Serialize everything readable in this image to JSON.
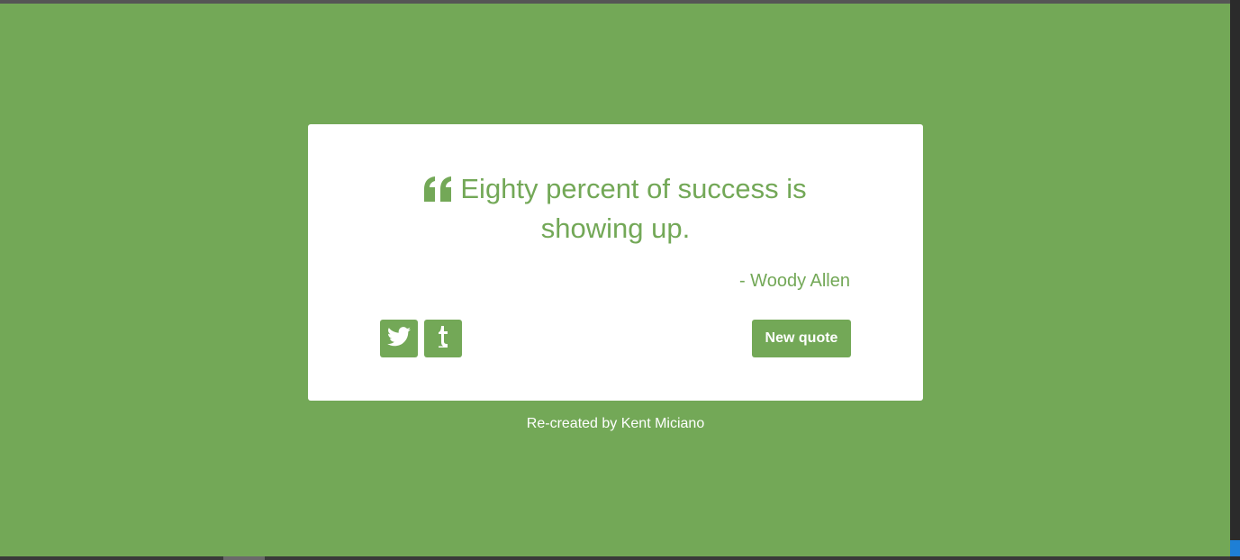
{
  "quote": {
    "text": "Eighty percent of success is showing up.",
    "author": "- Woody Allen",
    "quote_icon": "quote-left-icon"
  },
  "actions": {
    "twitter_icon": "twitter-icon",
    "tumblr_icon": "tumblr-icon",
    "new_quote_label": "New quote"
  },
  "footer": {
    "credit": "Re-created by Kent Miciano"
  },
  "colors": {
    "accent": "#73a857",
    "card": "#ffffff",
    "text_on_accent": "#ffffff"
  }
}
